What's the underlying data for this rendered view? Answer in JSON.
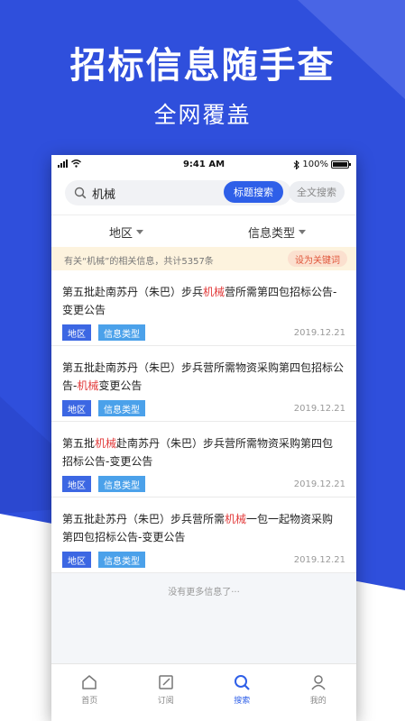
{
  "promo": {
    "title": "招标信息随手查",
    "subtitle": "全网覆盖",
    "brand_color": "#2f4fdc"
  },
  "status_bar": {
    "time": "9:41 AM",
    "battery": "100%"
  },
  "search": {
    "query": "机械",
    "title_search_label": "标题搜索",
    "fulltext_search_label": "全文搜索"
  },
  "filters": {
    "region_label": "地区",
    "type_label": "信息类型"
  },
  "notice": {
    "prefix": "有关“机械”的相关信息，共计5357条",
    "action_label": "设为关键词"
  },
  "results": [
    {
      "title_before": "第五批赴南苏丹（朱巴）步兵",
      "title_hl": "机械",
      "title_after": "营所需第四包招标公告-变更公告",
      "region_tag": "地区",
      "type_tag": "信息类型",
      "date": "2019.12.21"
    },
    {
      "title_before": "第五批赴南苏丹（朱巴）步兵营所需物资采购第四包招标公告-",
      "title_hl": "机械",
      "title_after": "变更公告",
      "region_tag": "地区",
      "type_tag": "信息类型",
      "date": "2019.12.21"
    },
    {
      "title_before": "第五批",
      "title_hl": "机械",
      "title_after": "赴南苏丹（朱巴）步兵营所需物资采购第四包招标公告-变更公告",
      "region_tag": "地区",
      "type_tag": "信息类型",
      "date": "2019.12.21"
    },
    {
      "title_before": "第五批赴苏丹（朱巴）步兵营所需",
      "title_hl": "机械",
      "title_after": "一包一起物资采购第四包招标公告-变更公告",
      "region_tag": "地区",
      "type_tag": "信息类型",
      "date": "2019.12.21"
    }
  ],
  "no_more_text": "没有更多信息了···",
  "tabbar": {
    "items": [
      {
        "label": "首页",
        "icon": "home-icon"
      },
      {
        "label": "订阅",
        "icon": "subscribe-icon"
      },
      {
        "label": "搜索",
        "icon": "search-icon"
      },
      {
        "label": "我的",
        "icon": "user-icon"
      }
    ],
    "active": "搜索"
  }
}
